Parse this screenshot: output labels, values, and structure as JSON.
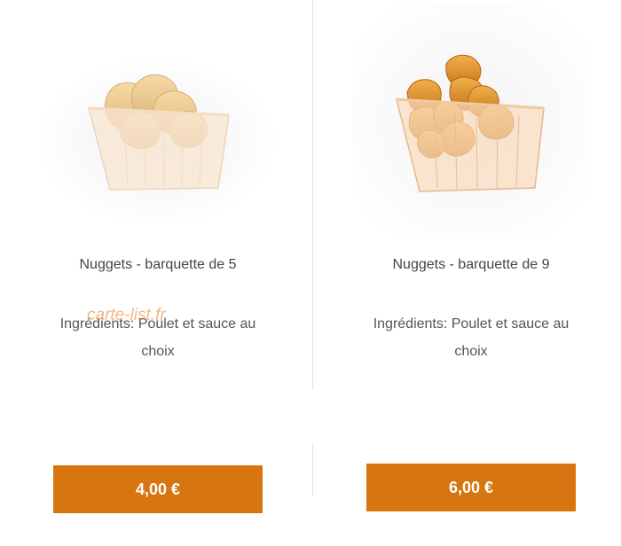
{
  "products": [
    {
      "title": "Nuggets - barquette de 5",
      "ingredients_line1": "Ingrédients: Poulet et sauce au",
      "ingredients_line2": "choix",
      "price": "4,00 €"
    },
    {
      "title": "Nuggets - barquette de 9",
      "ingredients_line1": "Ingrédients: Poulet et sauce au",
      "ingredients_line2": "choix",
      "price": "6,00 €"
    }
  ],
  "watermark": "carte-list.fr",
  "colors": {
    "button_bg": "#d77611",
    "button_text": "#ffffff"
  },
  "icons": [
    "nuggets-tray-image"
  ]
}
